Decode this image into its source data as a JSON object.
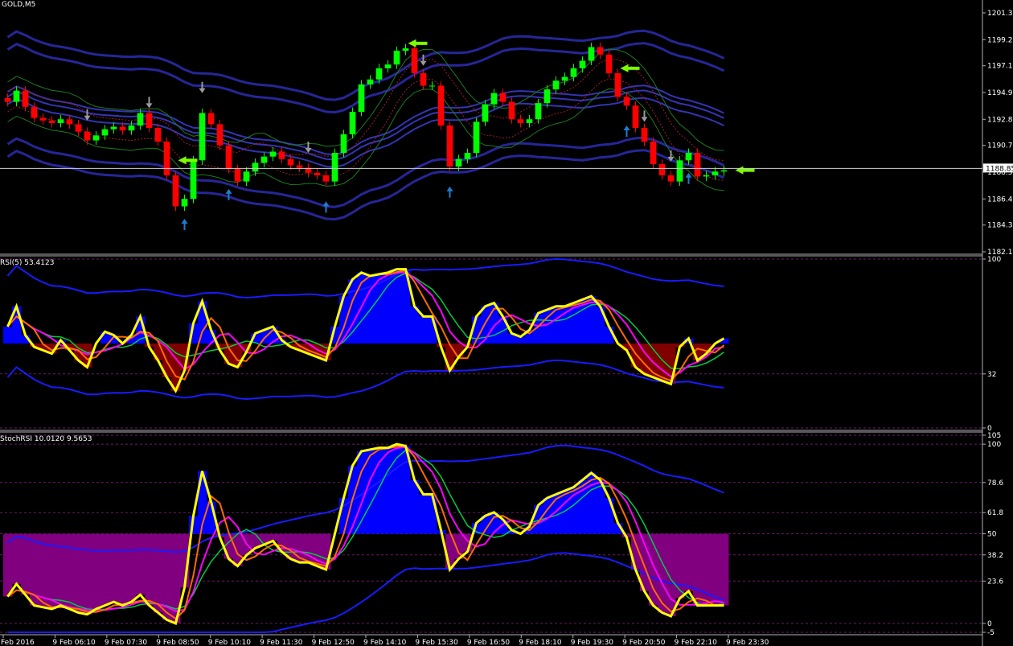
{
  "panels": {
    "price": {
      "title": "GOLD,M5",
      "price_ticks": [
        "1201.35",
        "1199.20",
        "1197.10",
        "1194.95",
        "1192.80",
        "1190.70",
        "1188.55",
        "1186.40",
        "1184.30",
        "1182.15"
      ],
      "current_price": "1188.85"
    },
    "rsi": {
      "title": "RSI(5) 53.4123",
      "levels": [
        "100",
        "32",
        "0"
      ]
    },
    "stoch": {
      "title": "StochRSI 10.0120 9.5653",
      "levels": [
        "105",
        "100",
        "78.6",
        "61.8",
        "50",
        "38.2",
        "23.6",
        "0",
        "-5"
      ]
    }
  },
  "time_axis": [
    "Feb 2016",
    "9 Feb 06:10",
    "9 Feb 07:30",
    "9 Feb 08:50",
    "9 Feb 10:10",
    "9 Feb 11:30",
    "9 Feb 12:50",
    "9 Feb 14:10",
    "9 Feb 15:30",
    "9 Feb 16:50",
    "9 Feb 18:10",
    "9 Feb 19:30",
    "9 Feb 20:50",
    "9 Feb 22:10",
    "9 Feb 23:30"
  ],
  "colors": {
    "background": "#000000",
    "bull_candle": "#00ff00",
    "bear_candle": "#ff0000",
    "envelope": "#2a2aa8",
    "osc_fast": "#ffff00",
    "hist_up": "#0000ff",
    "hist_down_rsi": "#800000",
    "hist_down_stoch": "#800080",
    "arrow": "#7cfc00"
  },
  "chart_data": [
    {
      "type": "candlestick",
      "title": "GOLD,M5",
      "ylim": [
        1182.15,
        1201.35
      ],
      "close": [
        1194.2,
        1195.1,
        1193.8,
        1192.9,
        1192.7,
        1192.5,
        1192.8,
        1192.4,
        1191.8,
        1191.1,
        1191.5,
        1192.0,
        1192.2,
        1191.9,
        1192.3,
        1193.3,
        1192.1,
        1191.0,
        1188.3,
        1185.8,
        1186.4,
        1189.5,
        1193.3,
        1192.4,
        1190.7,
        1188.8,
        1187.8,
        1188.6,
        1189.3,
        1189.8,
        1190.2,
        1189.6,
        1189.1,
        1188.9,
        1188.5,
        1188.3,
        1187.8,
        1190.1,
        1191.6,
        1193.4,
        1195.6,
        1196.0,
        1196.9,
        1197.2,
        1198.3,
        1198.5,
        1196.5,
        1195.5,
        1195.5,
        1192.3,
        1189.0,
        1189.6,
        1190.1,
        1192.6,
        1194.0,
        1194.9,
        1194.2,
        1192.8,
        1192.5,
        1192.8,
        1194.1,
        1195.2,
        1195.9,
        1196.2,
        1196.9,
        1197.5,
        1198.6,
        1198.0,
        1196.5,
        1194.6,
        1193.9,
        1192.1,
        1191.0,
        1189.2,
        1188.3,
        1187.8,
        1189.5,
        1190.1,
        1188.2,
        1188.3,
        1188.6,
        1188.7
      ],
      "arrows_down_at": [
        9,
        16,
        22,
        34,
        47,
        72,
        75
      ],
      "arrows_up_at": [
        20,
        25,
        36,
        50,
        70,
        77
      ]
    },
    {
      "type": "line",
      "title": "RSI(5) 53.4123",
      "ylim": [
        0,
        100
      ],
      "levels": [
        100,
        32,
        0
      ],
      "series": [
        {
          "name": "RSI(5)",
          "values": [
            60,
            72,
            55,
            48,
            46,
            44,
            52,
            46,
            40,
            36,
            50,
            57,
            55,
            50,
            55,
            66,
            48,
            40,
            30,
            22,
            34,
            62,
            75,
            58,
            46,
            38,
            36,
            45,
            56,
            58,
            60,
            52,
            48,
            46,
            44,
            42,
            40,
            60,
            78,
            88,
            92,
            90,
            91,
            92,
            94,
            94,
            72,
            66,
            66,
            48,
            34,
            42,
            48,
            66,
            72,
            74,
            66,
            56,
            54,
            58,
            68,
            70,
            72,
            72,
            74,
            76,
            78,
            72,
            60,
            50,
            46,
            36,
            32,
            30,
            28,
            26,
            48,
            53,
            40,
            44,
            50,
            53
          ]
        }
      ]
    },
    {
      "type": "line",
      "title": "StochRSI 10.0120 9.5653",
      "ylim": [
        -5,
        105
      ],
      "levels": [
        105,
        100,
        78.6,
        61.8,
        50,
        38.2,
        23.6,
        0,
        -5
      ],
      "series": [
        {
          "name": "StochRSI",
          "values": [
            15,
            22,
            16,
            10,
            9,
            8,
            10,
            8,
            6,
            5,
            8,
            10,
            12,
            10,
            12,
            16,
            10,
            6,
            2,
            0,
            20,
            60,
            85,
            68,
            48,
            36,
            32,
            38,
            42,
            44,
            46,
            40,
            36,
            34,
            34,
            32,
            30,
            50,
            70,
            88,
            96,
            97,
            98,
            98,
            100,
            99,
            80,
            72,
            72,
            52,
            30,
            36,
            40,
            56,
            60,
            62,
            58,
            52,
            50,
            54,
            66,
            70,
            72,
            74,
            76,
            80,
            84,
            80,
            70,
            56,
            48,
            30,
            18,
            10,
            6,
            4,
            14,
            18,
            10,
            10,
            10,
            10
          ]
        }
      ]
    }
  ]
}
